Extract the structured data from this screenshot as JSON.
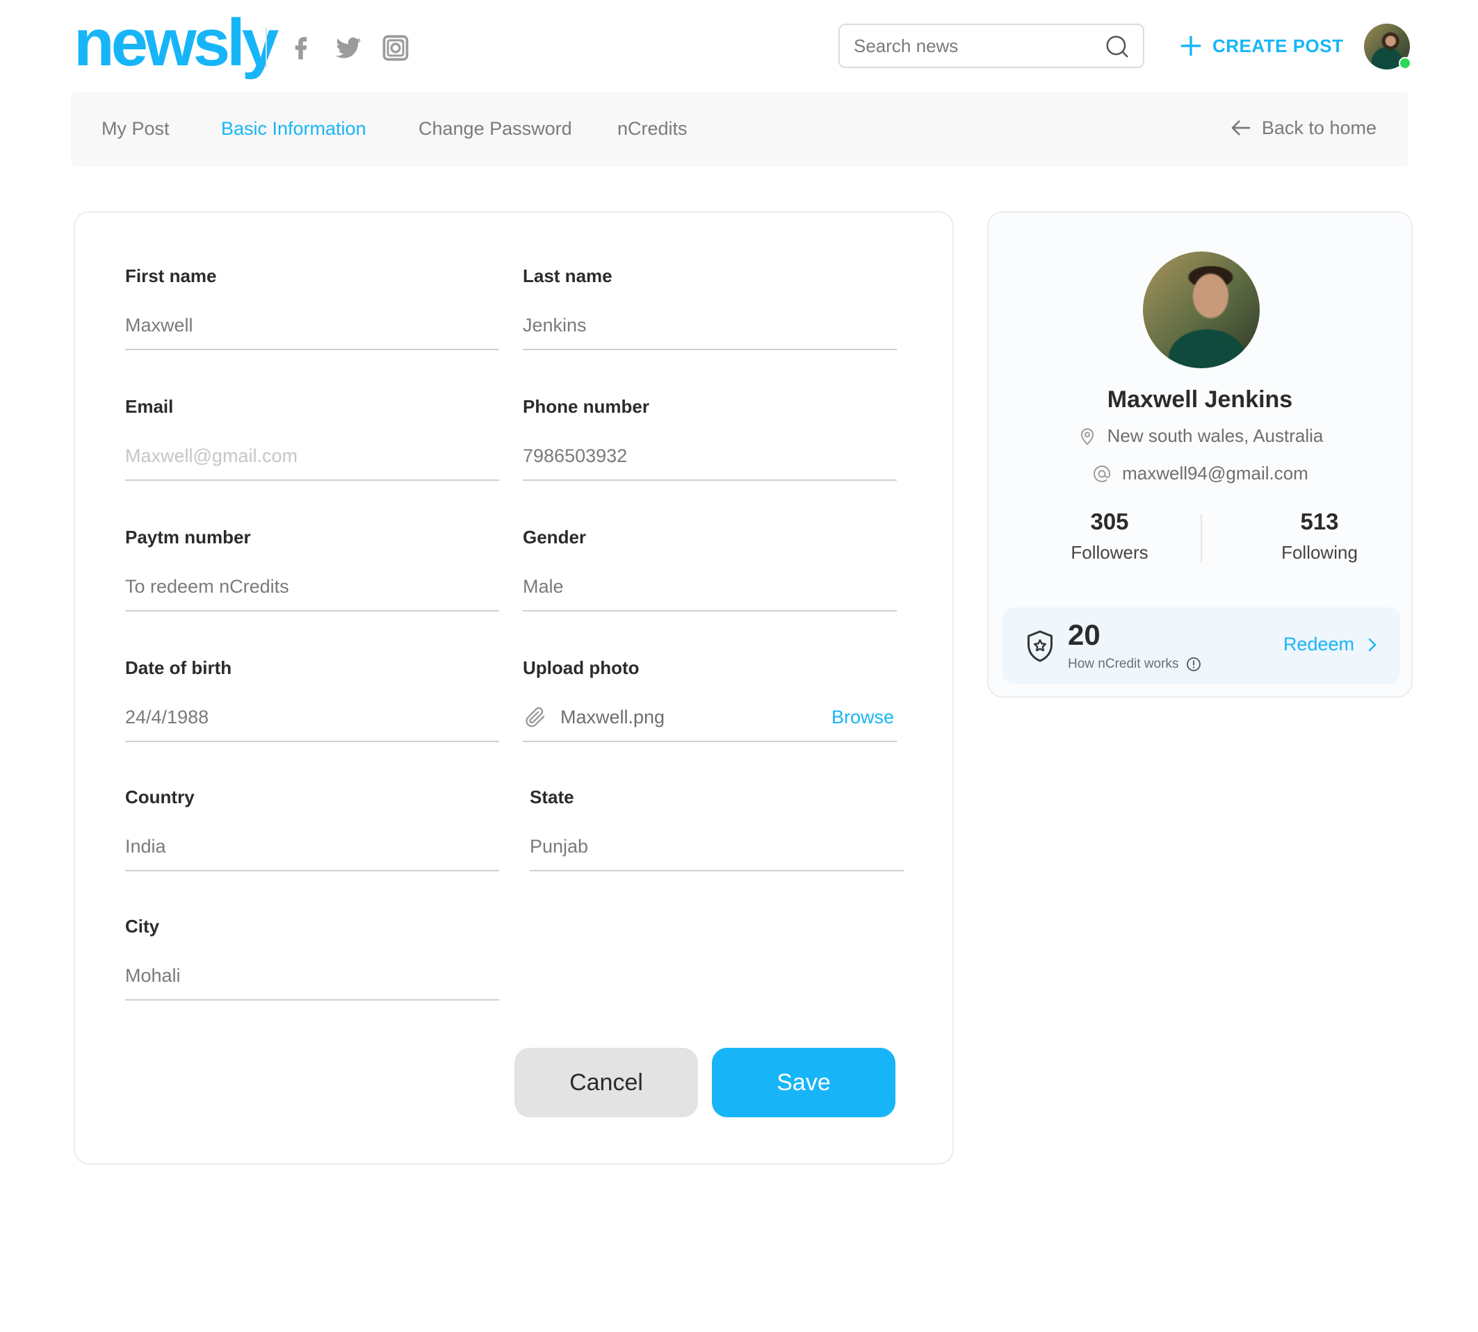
{
  "header": {
    "logo": "newsly",
    "social": [
      "facebook-icon",
      "twitter-icon",
      "instagram-icon"
    ],
    "search_placeholder": "Search news",
    "create_post": "CREATE POST"
  },
  "tabs": [
    {
      "label": "My Post",
      "active": false
    },
    {
      "label": "Basic Information",
      "active": true
    },
    {
      "label": "Change Password",
      "active": false
    },
    {
      "label": "nCredits",
      "active": false
    }
  ],
  "back_home": "Back to home",
  "form": {
    "first_name": {
      "label": "First name",
      "placeholder": "Maxwell"
    },
    "last_name": {
      "label": "Last name",
      "placeholder": "Jenkins"
    },
    "email": {
      "label": "Email",
      "placeholder": "Maxwell@gmail.com"
    },
    "phone": {
      "label": "Phone number",
      "placeholder": "7986503932"
    },
    "paytm": {
      "label": "Paytm number",
      "placeholder": "To redeem nCredits"
    },
    "gender": {
      "label": "Gender",
      "placeholder": "Male"
    },
    "dob": {
      "label": "Date of birth",
      "placeholder": "24/4/1988"
    },
    "upload": {
      "label": "Upload photo",
      "filename": "Maxwell.png",
      "browse": "Browse"
    },
    "country": {
      "label": "Country",
      "placeholder": "India"
    },
    "state": {
      "label": "State",
      "placeholder": "Punjab"
    },
    "city": {
      "label": "City",
      "placeholder": "Mohali"
    },
    "cancel": "Cancel",
    "save": "Save"
  },
  "profile": {
    "name": "Maxwell Jenkins",
    "location": "New south wales, Australia",
    "email": "maxwell94@gmail.com",
    "followers": {
      "count": "305",
      "label": "Followers"
    },
    "following": {
      "count": "513",
      "label": "Following"
    },
    "credits": "20",
    "how_it_works": "How nCredit works",
    "redeem": "Redeem"
  },
  "colors": {
    "accent": "#17b5f7",
    "online": "#2ed85a",
    "cancel_bg": "#e3e3e3",
    "credit_bg": "#eff6fc"
  }
}
